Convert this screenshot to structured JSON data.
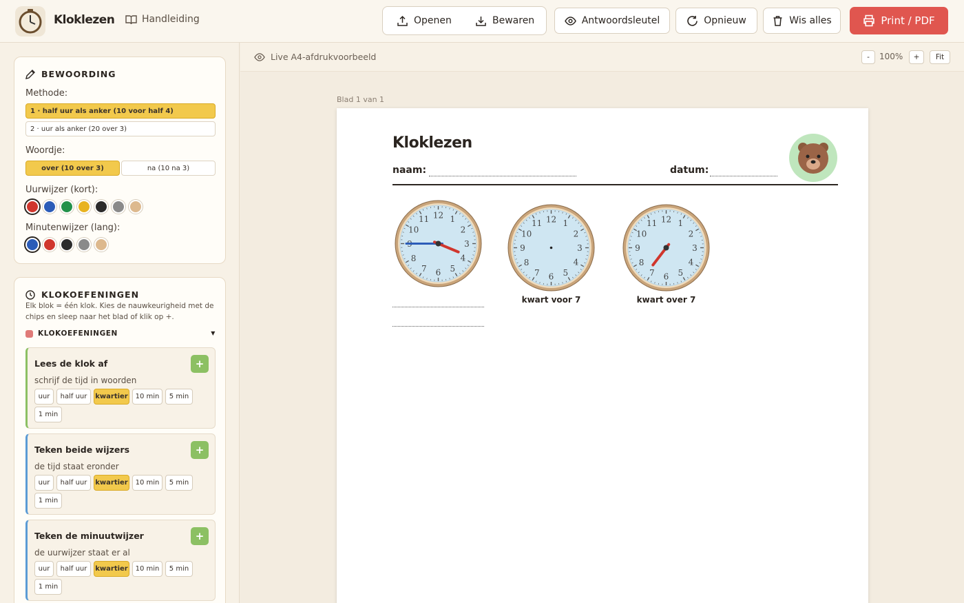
{
  "app": {
    "title": "Kloklezen",
    "manual": "Handleiding"
  },
  "toolbar": {
    "open": "Openen",
    "save": "Bewaren",
    "answer_key": "Antwoordsleutel",
    "restart": "Opnieuw",
    "clear_all": "Wis alles",
    "print": "Print / PDF"
  },
  "wording": {
    "title": "BEWOORDING",
    "method_label": "Methode:",
    "method_options": [
      "1 · half uur als anker (10 voor half 4)",
      "2 · uur als anker (20 over 3)"
    ],
    "method_selected": 0,
    "word_label": "Woordje:",
    "word_options": [
      "over (10 over 3)",
      "na (10 na 3)"
    ],
    "word_selected": 0,
    "hour_hand_label": "Uurwijzer (kort):",
    "hour_colors": [
      "#d0362d",
      "#2b5cb8",
      "#23914a",
      "#e8b320",
      "#2b2b2b",
      "#8a8a8a",
      "#ddb98e"
    ],
    "hour_selected": 0,
    "minute_hand_label": "Minutenwijzer (lang):",
    "minute_colors": [
      "#2b5cb8",
      "#d0362d",
      "#2b2b2b",
      "#8a8a8a",
      "#ddb98e"
    ],
    "minute_selected": 0
  },
  "exercises": {
    "title": "KLOKOEFENINGEN",
    "description": "Elk blok = één klok. Kies de nauwkeurigheid met de chips en sleep naar het blad of klik op +.",
    "section_label": "KLOKOEFENINGEN",
    "chips": [
      "uur",
      "half uur",
      "kwartier",
      "10 min",
      "5 min",
      "1 min"
    ],
    "items": [
      {
        "title": "Lees de klok af",
        "subtitle": "schrijf de tijd in woorden",
        "accent": "#8cc063",
        "selected_chip": 2
      },
      {
        "title": "Teken beide wijzers",
        "subtitle": "de tijd staat eronder",
        "accent": "#5b9bd5",
        "selected_chip": 2
      },
      {
        "title": "Teken de minuutwijzer",
        "subtitle": "de uurwijzer staat er al",
        "accent": "#5b9bd5",
        "selected_chip": 2
      }
    ]
  },
  "preview": {
    "label": "Live A4-afdrukvoorbeeld",
    "zoom": "100%",
    "zoom_out": "-",
    "zoom_in": "+",
    "fit": "Fit",
    "sheet_label": "Blad 1 van 1"
  },
  "worksheet": {
    "title": "Kloklezen",
    "name_label": "naam:",
    "date_label": "datum:",
    "clocks": [
      {
        "hour": 3,
        "minute": 45,
        "hour_color": "#d0362d",
        "minute_color": "#2b5cb8",
        "show_hour": true,
        "show_minute": true,
        "caption": ""
      },
      {
        "hour": 6,
        "minute": 45,
        "hour_color": "#d0362d",
        "minute_color": "#2b5cb8",
        "show_hour": false,
        "show_minute": false,
        "caption": "kwart voor 7"
      },
      {
        "hour": 7,
        "minute": 15,
        "hour_color": "#d0362d",
        "minute_color": "#2b5cb8",
        "show_hour": true,
        "show_minute": false,
        "caption": "kwart over 7"
      }
    ]
  }
}
